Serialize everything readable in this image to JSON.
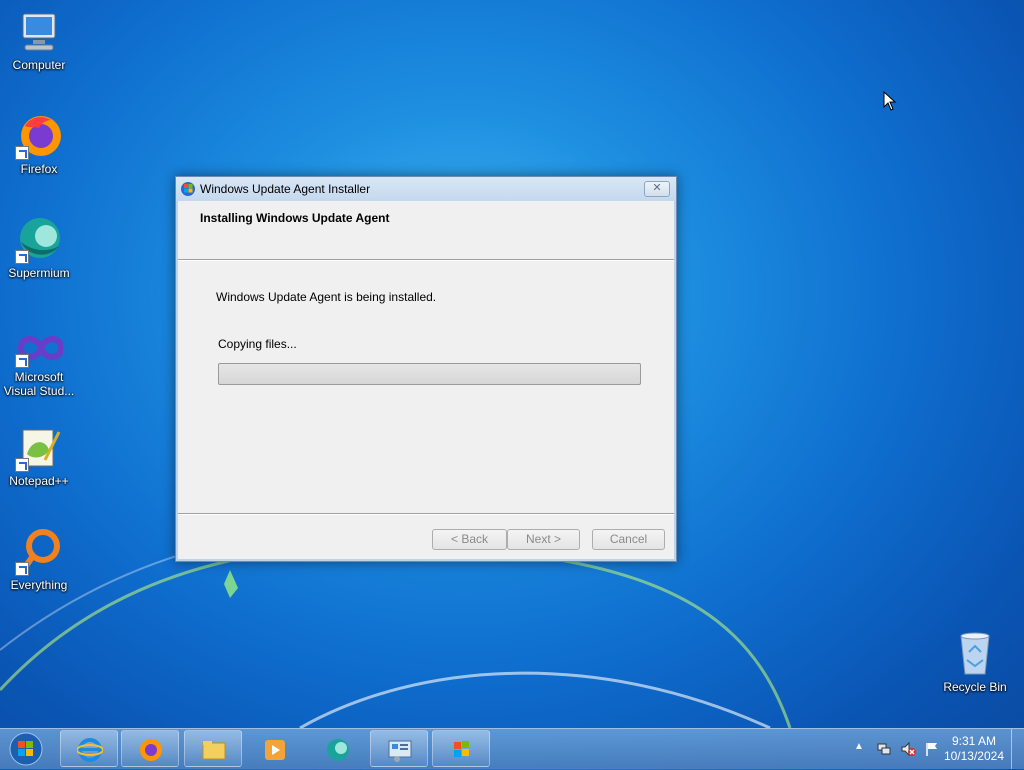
{
  "desktop": {
    "icons": [
      {
        "label": "Computer",
        "icon": "computer-icon"
      },
      {
        "label": "Firefox",
        "icon": "firefox-icon"
      },
      {
        "label": "Supermium",
        "icon": "supermium-icon"
      },
      {
        "label": "Microsoft Visual Stud...",
        "label_line1": "Microsoft",
        "label_line2": "Visual Stud...",
        "icon": "visual-studio-icon"
      },
      {
        "label": "Notepad++",
        "icon": "notepadpp-icon"
      },
      {
        "label": "Everything",
        "icon": "everything-icon"
      },
      {
        "label": "Recycle Bin",
        "icon": "recycle-bin-icon"
      }
    ]
  },
  "dialog": {
    "title": "Windows Update Agent Installer",
    "close_label": "✕",
    "header_title": "Installing Windows Update Agent",
    "status_message": "Windows Update Agent is being installed.",
    "progress_label": "Copying files...",
    "progress_fraction": 0.0,
    "buttons": {
      "back": "< Back",
      "next": "Next >",
      "cancel": "Cancel"
    }
  },
  "taskbar": {
    "pinned": [
      "internet-explorer-icon",
      "firefox-icon",
      "file-explorer-icon",
      "media-player-icon",
      "supermium-icon",
      "control-panel-icon",
      "windows-update-icon"
    ],
    "clock": {
      "time": "9:31 AM",
      "date": "10/13/2024"
    },
    "tray_icons": [
      "show-hidden-icons-icon",
      "network-icon",
      "volume-muted-icon",
      "action-center-flag-icon"
    ]
  },
  "colors": {
    "accent": "#1d8ee0",
    "progress_fill": "#3cb43c"
  }
}
